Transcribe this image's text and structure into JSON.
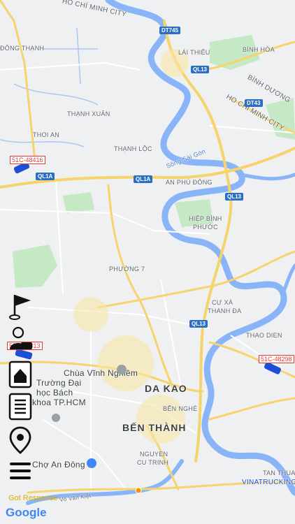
{
  "map": {
    "labels": {
      "hcm_city_top": "HỒ CHÍ MINH CITY",
      "dong_thanh": "ĐÔNG THẠNH",
      "lai_thieu": "LÁI THIÊU",
      "binh_hoa": "BÌNH HÒA",
      "binh_duong": "BÌNH DƯƠNG",
      "hcm_city_right": "HO CHI MINH CITY",
      "thanh_xuan": "THẠNH XUÂN",
      "thoi_an": "THOI AN",
      "thanh_loc": "THẠNH LỘC",
      "song_sai_gon": "Sông Sài Gòn",
      "an_phu_dong": "AN PHÚ ĐÔNG",
      "hiep_binh_phuoc_1": "HIỆP BÌNH",
      "hiep_binh_phuoc_2": "PHƯỚC",
      "phuong_7": "PHƯỜNG 7",
      "cu_xa_1": "CƯ XÁ",
      "cu_xa_2": "THANH ĐA",
      "thao_dien": "THAO DIEN",
      "da_kao": "DA KAO",
      "ben_nghe": "BẾN NGHÉ",
      "ben_thanh": "BẾN THÀNH",
      "nguyen_cu_trinh_1": "NGUYEN",
      "nguyen_cu_trinh_2": "CU TRINH",
      "tan_thuan": "TAN THUAN",
      "vo_van_kiet": "Võ Văn Kiệt"
    },
    "pois": {
      "chua_vinh_nghiem": "Chùa Vĩnh Nghiêm",
      "dh_bach_khoa_1": "Trường Đại",
      "dh_bach_khoa_2": "học Bách",
      "dh_bach_khoa_3": "khoa TP.HCM",
      "cho_an_dong": "Chợ An Đông"
    },
    "shields": {
      "dt745": "DT745",
      "ql13_a": "QL13",
      "dt43": "DT43",
      "ql1a_left": "QL1A",
      "ql1a_mid": "QL1A",
      "ql13_b": "QL13",
      "ql13_c": "QL13"
    },
    "plates": {
      "truck_left": "51C-48416",
      "truck_mid": "57C-48313",
      "truck_right": "51C-48298"
    },
    "other_labels": {
      "vinatruck": "VINATRUCKING"
    },
    "colors": {
      "land": "#eef0f2",
      "water": "#8ab4f8",
      "park": "#c5e8c5",
      "major_road": "#f6d36b",
      "road": "#ffffff",
      "shield": "#2a6ec6",
      "plate": "#e53935",
      "vehicle": "#1a4fd6"
    }
  },
  "sidebar": {
    "buttons": [
      {
        "icon": "flag-icon"
      },
      {
        "icon": "driver-icon"
      },
      {
        "icon": "home-icon"
      },
      {
        "icon": "list-icon"
      },
      {
        "icon": "location-pin-icon"
      },
      {
        "icon": "menu-icon"
      }
    ]
  },
  "footer": {
    "status_text": "Got Response",
    "google_logo": "Google"
  }
}
